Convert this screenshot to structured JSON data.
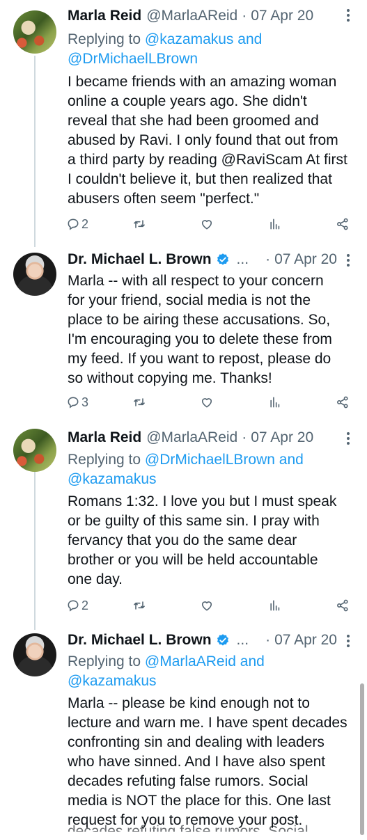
{
  "tweets": [
    {
      "name": "Marla Reid",
      "handle": "@MarlaAReid",
      "dot": "·",
      "date": "07 Apr 20",
      "reply_prefix": "Replying to ",
      "reply_first": "@kazamakus",
      "reply_and": " and",
      "reply_second": "@DrMichaelLBrown",
      "lines": [
        "I became friends with an amazing woman",
        "online a couple years ago.  She didn't",
        "reveal that she had been groomed and",
        "abused by Ravi.  I only found that out from",
        "a third party by reading @RaviScam At first",
        "I couldn't believe it, but then realized that",
        "abusers often seem \"perfect.\""
      ],
      "reply_count": "2"
    },
    {
      "name": "Dr. Michael L. Brown",
      "ellipsis": "...",
      "dot": "·",
      "date": "07 Apr 20",
      "lines": [
        "Marla -- with all respect to your concern",
        "for your friend, social media is not the",
        "place to be airing these accusations. So,",
        "I'm encouraging you to delete these from",
        "my feed. If you want to repost, please do",
        "so without copying me. Thanks!"
      ],
      "reply_count": "3"
    },
    {
      "name": "Marla Reid",
      "handle": "@MarlaAReid",
      "dot": "·",
      "date": "07 Apr 20",
      "reply_prefix": "Replying to ",
      "reply_first": "@DrMichaelLBrown",
      "reply_and": " and",
      "reply_second": "@kazamakus",
      "lines": [
        "Romans 1:32.  I love you but I must speak",
        "or be guilty of this same sin.  I pray with",
        "fervancy that you do the same dear",
        "brother or you will be held accountable",
        "one day."
      ],
      "reply_count": "2"
    },
    {
      "name": "Dr. Michael L. Brown",
      "ellipsis": "...",
      "dot": "·",
      "date": "07 Apr 20",
      "reply_prefix": "Replying to ",
      "reply_first": "@MarlaAReid",
      "reply_and": " and",
      "reply_second": "@kazamakus",
      "lines": [
        "Marla -- please be kind enough not to",
        "lecture and warn me. I have spent decades",
        "confronting sin and dealing with leaders",
        "who have sinned. And I have also spent",
        "decades refuting false rumors. Social",
        "media is NOT the place for this. One last",
        "request for you to remove your post."
      ],
      "ghost_line": "decades refuting false rumors. Social"
    }
  ],
  "icons": {
    "reply": "reply-icon",
    "retweet": "retweet-icon",
    "like": "heart-icon",
    "views": "views-icon",
    "share": "share-icon",
    "verified": "verified-badge-icon",
    "more": "more-icon"
  },
  "colors": {
    "text": "#0f1419",
    "secondary": "#536471",
    "link": "#1d9bf0",
    "verified": "#1d9bf0",
    "divider": "#cfd9de"
  }
}
